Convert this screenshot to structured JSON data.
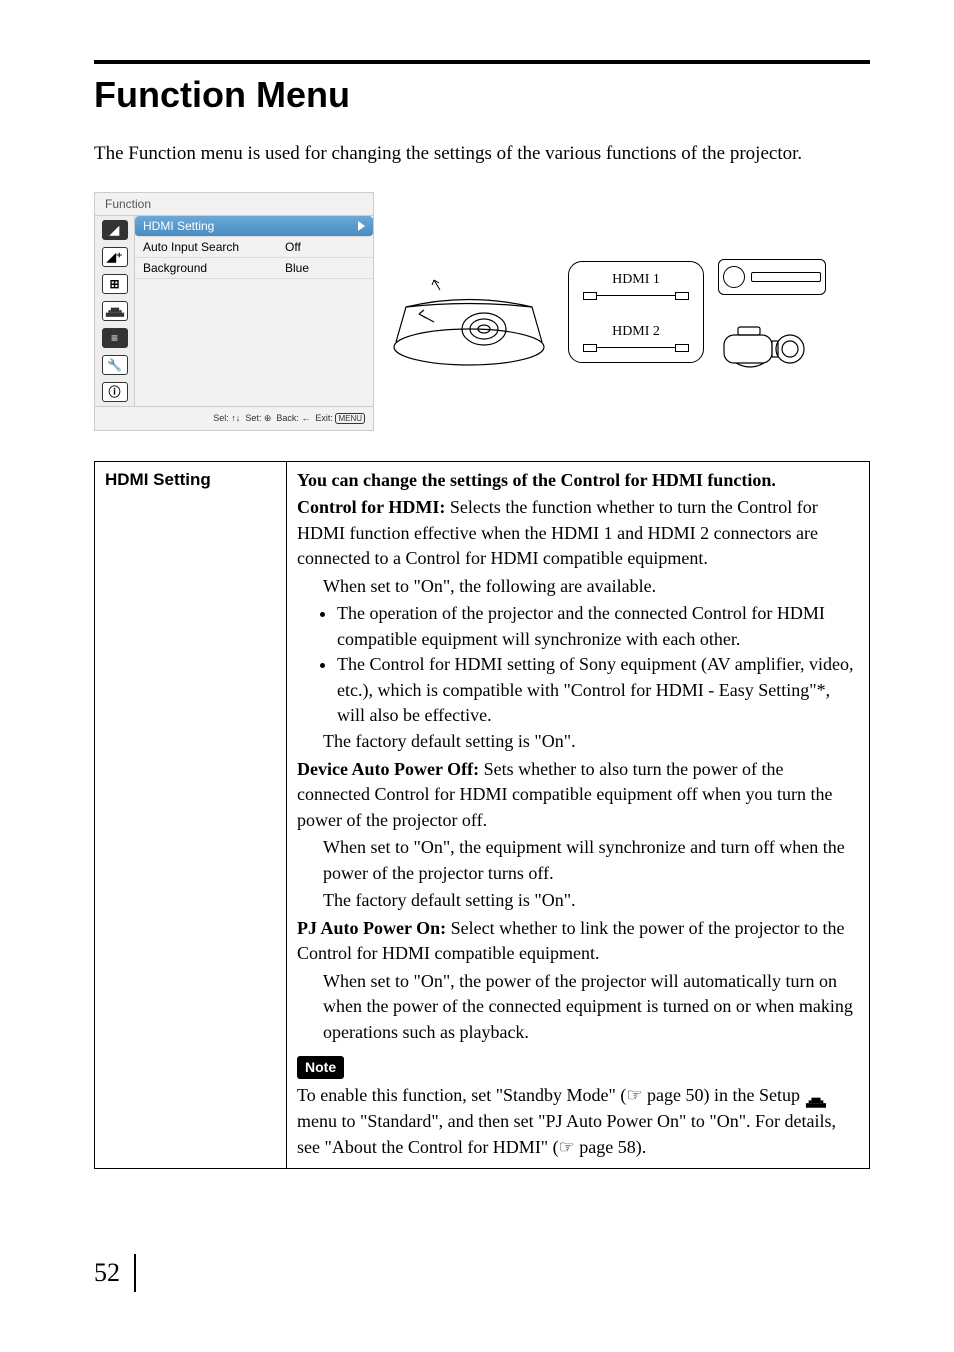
{
  "page": {
    "number": "52",
    "title": "Function Menu",
    "intro": "The Function menu is used for changing the settings of the various functions of the projector."
  },
  "menu_panel": {
    "header": "Function",
    "rows": [
      {
        "label": "HDMI Setting",
        "value": "",
        "selected": true
      },
      {
        "label": "Auto Input Search",
        "value": "Off",
        "selected": false
      },
      {
        "label": "Background",
        "value": "Blue",
        "selected": false
      }
    ],
    "footer_sel": "Sel:",
    "footer_set": "Set:",
    "footer_back": "Back:",
    "footer_exit": "Exit:",
    "footer_menu": "MENU"
  },
  "hdmi": {
    "port1": "HDMI 1",
    "port2": "HDMI 2"
  },
  "spec": {
    "row_heading": "HDMI Setting",
    "lead": "You can change the settings of the Control for HDMI function.",
    "control_label": "Control for HDMI:",
    "control_text": " Selects the function whether to turn the Control for HDMI function effective when the HDMI 1 and HDMI 2 connectors are connected to a Control for HDMI compatible equipment.",
    "control_on": "When set to \"On\", the following are available.",
    "bullet1": "The operation of the projector and the connected Control for HDMI compatible equipment will synchronize with each other.",
    "bullet2": "The Control for HDMI setting of Sony equipment (AV amplifier, video, etc.), which is compatible with \"Control for HDMI - Easy Setting\"*, will also be effective.",
    "control_default": "The factory default setting is \"On\".",
    "dapo_label": "Device Auto Power Off:",
    "dapo_text": " Sets whether to also turn the power of the connected Control for HDMI compatible equipment off when you turn the power of the projector off.",
    "dapo_on": "When set to \"On\", the equipment will synchronize and turn off when the power of the projector turns off.",
    "dapo_default": "The factory default setting is \"On\".",
    "pjon_label": "PJ Auto Power On:",
    "pjon_text": " Select whether to link the power of the projector to the Control for HDMI compatible equipment.",
    "pjon_on": "When set to \"On\", the power of the projector will automatically turn on when the power of the connected equipment is turned on or when making operations such as playback.",
    "note_label": "Note",
    "note_pre": "To enable this function, set \"Standby Mode\" (",
    "note_pageref1": " page 50) in the Setup ",
    "note_mid": " menu to \"Standard\", and then set \"PJ Auto Power On\" to \"On\". For details, see \"About the Control for HDMI\" (",
    "note_pageref2": " page 58)."
  }
}
